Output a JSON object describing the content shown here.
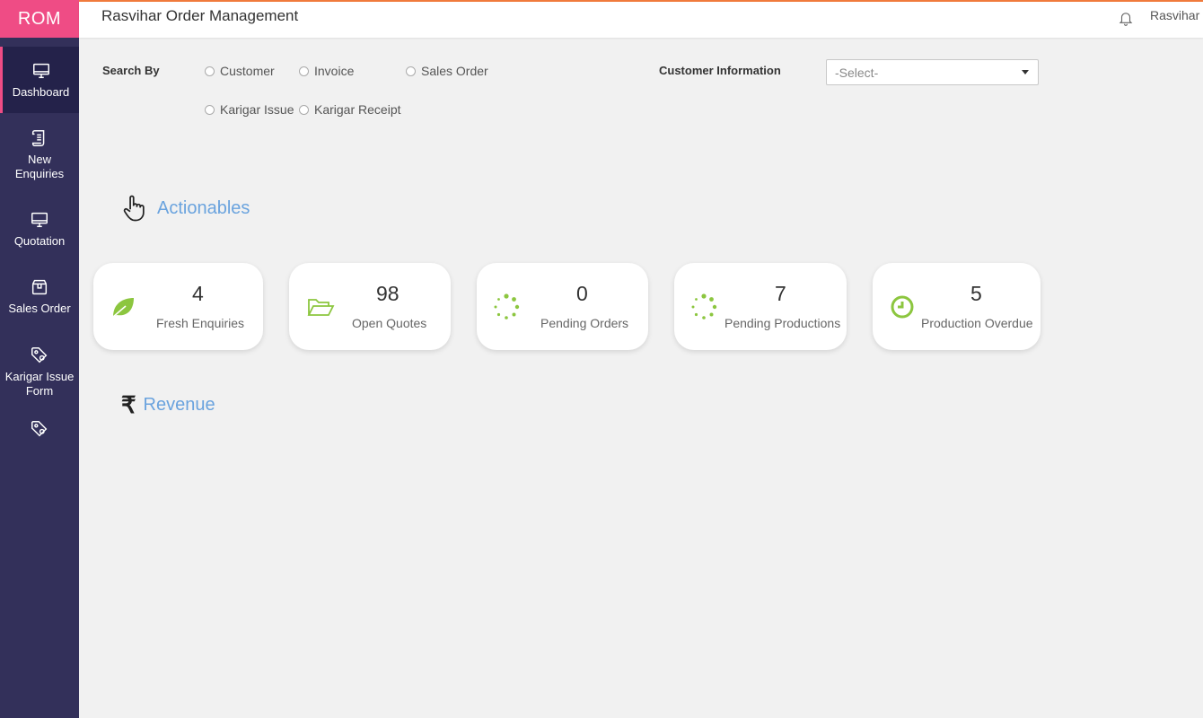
{
  "brand": "ROM",
  "app_title": "Rasvihar Order Management",
  "user_name": "Rasvihar",
  "sidebar": {
    "items": [
      {
        "label": "Dashboard",
        "icon": "monitor-icon"
      },
      {
        "label": "New Enquiries",
        "icon": "scroll-icon"
      },
      {
        "label": "Quotation",
        "icon": "monitor-icon"
      },
      {
        "label": "Sales Order",
        "icon": "box-icon"
      },
      {
        "label": "Karigar Issue Form",
        "icon": "tag-icon"
      },
      {
        "label": "",
        "icon": "tag-icon"
      }
    ]
  },
  "search": {
    "label": "Search By",
    "options": [
      "Customer",
      "Invoice",
      "Sales Order",
      "Karigar Issue",
      "Karigar Receipt"
    ],
    "customer_info_label": "Customer Information",
    "select_value": "-Select-"
  },
  "actionables": {
    "title": "Actionables",
    "cards": [
      {
        "value": "4",
        "label": "Fresh Enquiries",
        "icon": "leaf-icon"
      },
      {
        "value": "98",
        "label": "Open Quotes",
        "icon": "folder-open-icon"
      },
      {
        "value": "0",
        "label": "Pending Orders",
        "icon": "spinner-icon"
      },
      {
        "value": "7",
        "label": "Pending Productions",
        "icon": "spinner-icon"
      },
      {
        "value": "5",
        "label": "Production Overdue",
        "icon": "clock-icon"
      }
    ]
  },
  "revenue": {
    "title": "Revenue",
    "currency_symbol": "₹"
  },
  "colors": {
    "brand": "#ef4c85",
    "sidebar": "#33305a",
    "accent_green": "#8cc63f",
    "heading_blue": "#6aa3de",
    "topbar_border": "#f07a3c"
  }
}
